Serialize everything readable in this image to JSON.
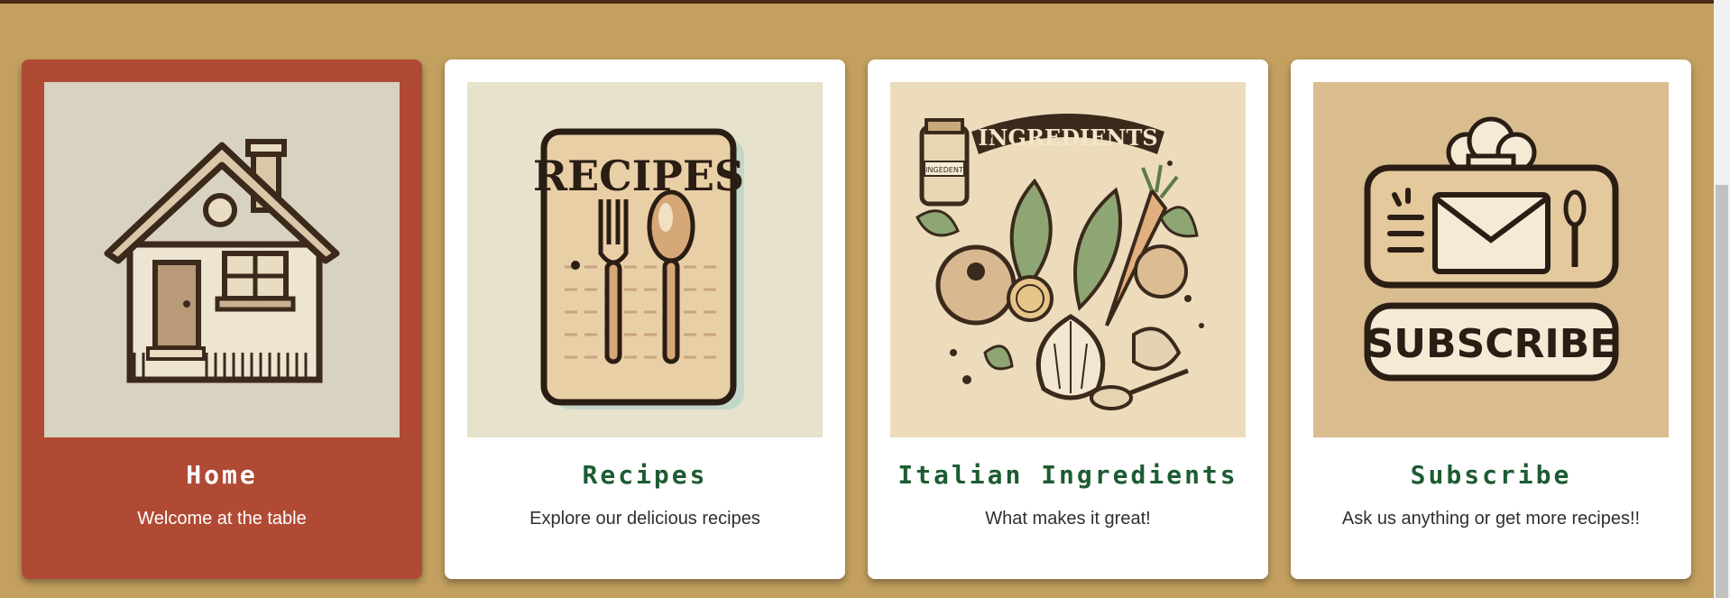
{
  "cards": [
    {
      "title": "Home",
      "subtitle": "Welcome at the table",
      "image_icon": "house-icon"
    },
    {
      "title": "Recipes",
      "subtitle": "Explore our delicious recipes",
      "image_icon": "recipes-card-icon",
      "image_text": "RECIPES"
    },
    {
      "title": "Italian Ingredients",
      "subtitle": "What makes it great!",
      "image_icon": "ingredients-illustration",
      "image_text": "INGREDIENTS",
      "jar_label": "INGEDENT"
    },
    {
      "title": "Subscribe",
      "subtitle": "Ask us anything or get more recipes!!",
      "image_icon": "subscribe-envelope-icon",
      "image_text": "SUBSCRIBE"
    }
  ],
  "colors": {
    "page_background": "#c3a05f",
    "active_card": "#b04a34",
    "card": "#ffffff",
    "title_green": "#1d5c33",
    "top_bar": "#4a2a14"
  }
}
